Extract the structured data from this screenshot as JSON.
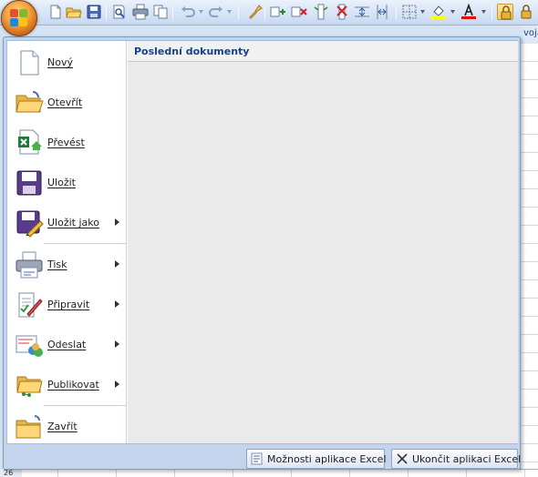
{
  "toolbar": {
    "icons": [
      "new-icon",
      "open-icon",
      "save-icon",
      "print-preview-icon",
      "print-icon",
      "copy-icon",
      "undo-icon",
      "redo-icon",
      "format-painter-icon",
      "insert-cells-icon",
      "delete-cells-icon",
      "insert-column-icon",
      "delete-column-icon",
      "row-height-icon",
      "column-width-icon",
      "borders-icon",
      "fill-color-icon",
      "font-color-icon",
      "lock-icon",
      "lock-alt-icon"
    ],
    "tab_fragment": "voja"
  },
  "menu": {
    "items": [
      {
        "label": "Nový",
        "icon": "new-document-icon",
        "submenu": false
      },
      {
        "label": "Otevřít",
        "icon": "open-folder-icon",
        "submenu": false
      },
      {
        "label": "Převést",
        "icon": "convert-icon",
        "submenu": false
      },
      {
        "label": "Uložit",
        "icon": "save-icon",
        "submenu": false
      },
      {
        "label": "Uložit jako",
        "icon": "save-as-icon",
        "submenu": true
      },
      {
        "label": "Tisk",
        "icon": "print-icon",
        "submenu": true
      },
      {
        "label": "Připravit",
        "icon": "prepare-icon",
        "submenu": true
      },
      {
        "label": "Odeslat",
        "icon": "send-icon",
        "submenu": true
      },
      {
        "label": "Publikovat",
        "icon": "publish-icon",
        "submenu": true
      },
      {
        "label": "Zavřít",
        "icon": "close-folder-icon",
        "submenu": false
      }
    ],
    "recent_title": "Poslední dokumenty",
    "options_label": "Možnosti aplikace Excel",
    "exit_label": "Ukončit aplikaci Excel"
  },
  "sheet": {
    "row_number": "26"
  },
  "colors": {
    "accent": "#15428b",
    "panel": "#c3d4ec",
    "office_orange": "#f6a23c"
  }
}
